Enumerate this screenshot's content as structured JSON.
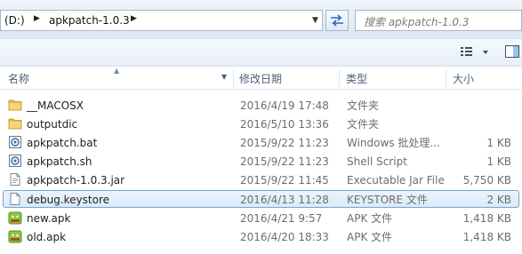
{
  "address_bar": {
    "breadcrumbs": [
      {
        "label": "(D:)"
      },
      {
        "label": "apkpatch-1.0.3"
      }
    ]
  },
  "search": {
    "placeholder": "搜索 apkpatch-1.0.3"
  },
  "columns": {
    "name": "名称",
    "date": "修改日期",
    "type": "类型",
    "size": "大小"
  },
  "files": [
    {
      "name": "__MACOSX",
      "date": "2016/4/19 17:48",
      "type": "文件夹",
      "size": "",
      "icon": "folder-icon"
    },
    {
      "name": "outputdic",
      "date": "2016/5/10 13:36",
      "type": "文件夹",
      "size": "",
      "icon": "folder-icon"
    },
    {
      "name": "apkpatch.bat",
      "date": "2015/9/22 11:23",
      "type": "Windows 批处理...",
      "size": "1 KB",
      "icon": "script-icon"
    },
    {
      "name": "apkpatch.sh",
      "date": "2015/9/22 11:23",
      "type": "Shell Script",
      "size": "1 KB",
      "icon": "script-icon"
    },
    {
      "name": "apkpatch-1.0.3.jar",
      "date": "2015/9/22 11:45",
      "type": "Executable Jar File",
      "size": "5,750 KB",
      "icon": "jar-icon"
    },
    {
      "name": "debug.keystore",
      "date": "2016/4/13 11:28",
      "type": "KEYSTORE 文件",
      "size": "2 KB",
      "icon": "blank-file-icon",
      "selected": true
    },
    {
      "name": "new.apk",
      "date": "2016/4/21 9:57",
      "type": "APK 文件",
      "size": "1,418 KB",
      "icon": "apk-icon"
    },
    {
      "name": "old.apk",
      "date": "2016/4/20 18:33",
      "type": "APK 文件",
      "size": "1,418 KB",
      "icon": "apk-icon"
    }
  ]
}
